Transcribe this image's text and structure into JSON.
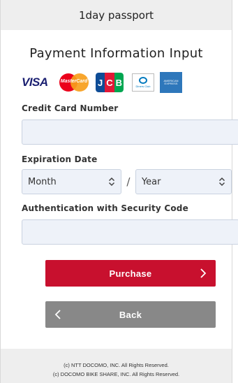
{
  "header": {
    "title": "1day passport"
  },
  "page": {
    "title": "Payment Information Input"
  },
  "card_brands": {
    "visa": "VISA",
    "mastercard": "MasterCard",
    "jcb": [
      "J",
      "C",
      "B"
    ],
    "diners": "Diners Club",
    "amex": "AMERICAN EXPRESS"
  },
  "form": {
    "card_number_label": "Credit Card Number",
    "card_number_value": "",
    "expiration_label": "Expiration Date",
    "month_value": "Month",
    "separator": "/",
    "year_value": "Year",
    "security_label": "Authentication with Security Code",
    "security_value": ""
  },
  "buttons": {
    "purchase_label": "Purchase",
    "back_label": "Back"
  },
  "footer": {
    "line1": "(c) NTT DOCOMO, INC. All Rights Reserved.",
    "line2": "(c) DOCOMO BIKE SHARE, INC. All Rights Reserved."
  },
  "colors": {
    "purchase_bg": "#c8102e",
    "back_bg": "#888888",
    "field_bg": "#eef2f9",
    "header_bg": "#eeeeee"
  }
}
